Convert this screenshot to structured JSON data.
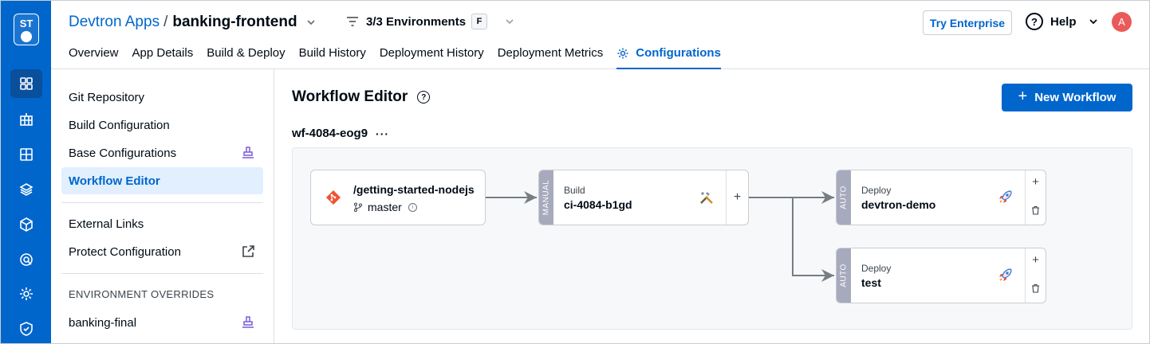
{
  "rail": {
    "logo": "ST",
    "items": [
      "apps-icon",
      "charts-icon",
      "resources-icon",
      "stack-icon",
      "cube-icon",
      "security-icon",
      "settings-icon",
      "shield-icon"
    ]
  },
  "header": {
    "breadcrumb_root": "Devtron Apps",
    "breadcrumb_sep": "/",
    "app_name": "banking-frontend",
    "env_filter": "3/3 Environments",
    "env_badge": "F",
    "try_enterprise": "Try Enterprise",
    "help": "Help",
    "avatar": "A",
    "tabs": [
      "Overview",
      "App Details",
      "Build & Deploy",
      "Build History",
      "Deployment History",
      "Deployment Metrics",
      "Configurations"
    ],
    "active_tab": "Configurations"
  },
  "sidebar": {
    "items": [
      "Git Repository",
      "Build Configuration",
      "Base Configurations",
      "Workflow Editor",
      "External Links",
      "Protect Configuration"
    ],
    "active_item": "Workflow Editor",
    "overrides_heading": "ENVIRONMENT OVERRIDES",
    "overrides": [
      "banking-final"
    ]
  },
  "main": {
    "title": "Workflow Editor",
    "new_workflow": "New Workflow",
    "workflow_name": "wf-4084-eog9",
    "source": {
      "repo": "/getting-started-nodejs",
      "branch": "master"
    },
    "build": {
      "tag": "MANUAL",
      "kind": "Build",
      "name": "ci-4084-b1gd",
      "add": "+"
    },
    "deploys": [
      {
        "tag": "AUTO",
        "kind": "Deploy",
        "name": "devtron-demo",
        "add": "+"
      },
      {
        "tag": "AUTO",
        "kind": "Deploy",
        "name": "test",
        "add": "+"
      }
    ]
  },
  "colors": {
    "brand": "#0066cc",
    "active_bg": "#e1efff",
    "stage_tag": "#a7a9bd",
    "avatar": "#ea5a5a"
  }
}
